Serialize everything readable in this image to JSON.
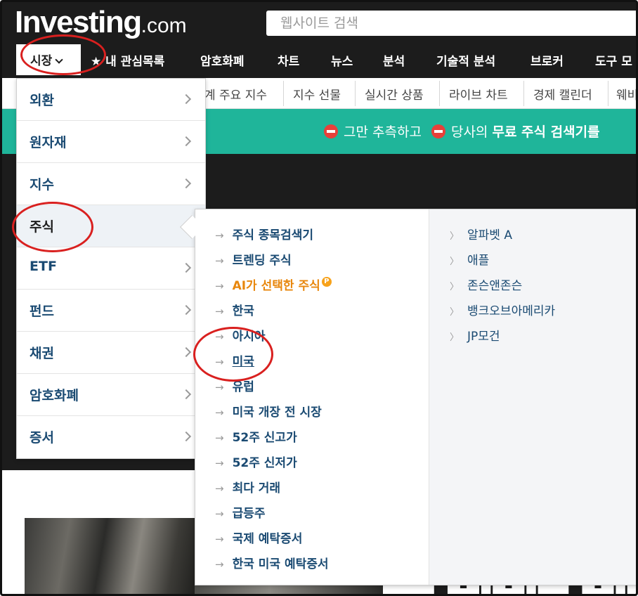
{
  "header": {
    "logo_main": "Investing",
    "logo_suffix": ".com",
    "search_placeholder": "웹사이트 검색"
  },
  "main_nav": {
    "items": [
      "시장",
      "내 관심목록",
      "암호화폐",
      "차트",
      "뉴스",
      "분석",
      "기술적 분석",
      "브로커",
      "도구 모"
    ]
  },
  "sub_nav": {
    "items": [
      "계 주요 지수",
      "지수 선물",
      "실시간 상품",
      "라이브 차트",
      "경제 캘린더",
      "웨비"
    ]
  },
  "banner": {
    "part1": "그만 추측하고",
    "part2": "당사의",
    "part3": "무료 주식 검색기를"
  },
  "markets_menu": {
    "items": [
      "외환",
      "원자재",
      "지수",
      "주식",
      "ETF",
      "펀드",
      "채권",
      "암호화폐",
      "증서"
    ],
    "active": "주식"
  },
  "stocks_submenu": {
    "items": [
      "주식 종목검색기",
      "트렌딩 주식",
      "AI가 선택한 주식",
      "한국",
      "아시아",
      "미국",
      "유럽",
      "미국 개장 전 시장",
      "52주 신고가",
      "52주 신저가",
      "최다 거래",
      "급등주",
      "국제 예탁증서",
      "한국 미국 예탁증서"
    ],
    "pro_badge": "P",
    "companies": [
      "알파벳 A",
      "애플",
      "존슨앤존슨",
      "뱅크오브아메리카",
      "JP모건"
    ]
  },
  "colors": {
    "brand_dark": "#1c1c1c",
    "banner_green": "#1fb59a",
    "link_blue": "#1a4a72",
    "ai_orange": "#e8870d",
    "annotation_red": "#d9201f"
  }
}
